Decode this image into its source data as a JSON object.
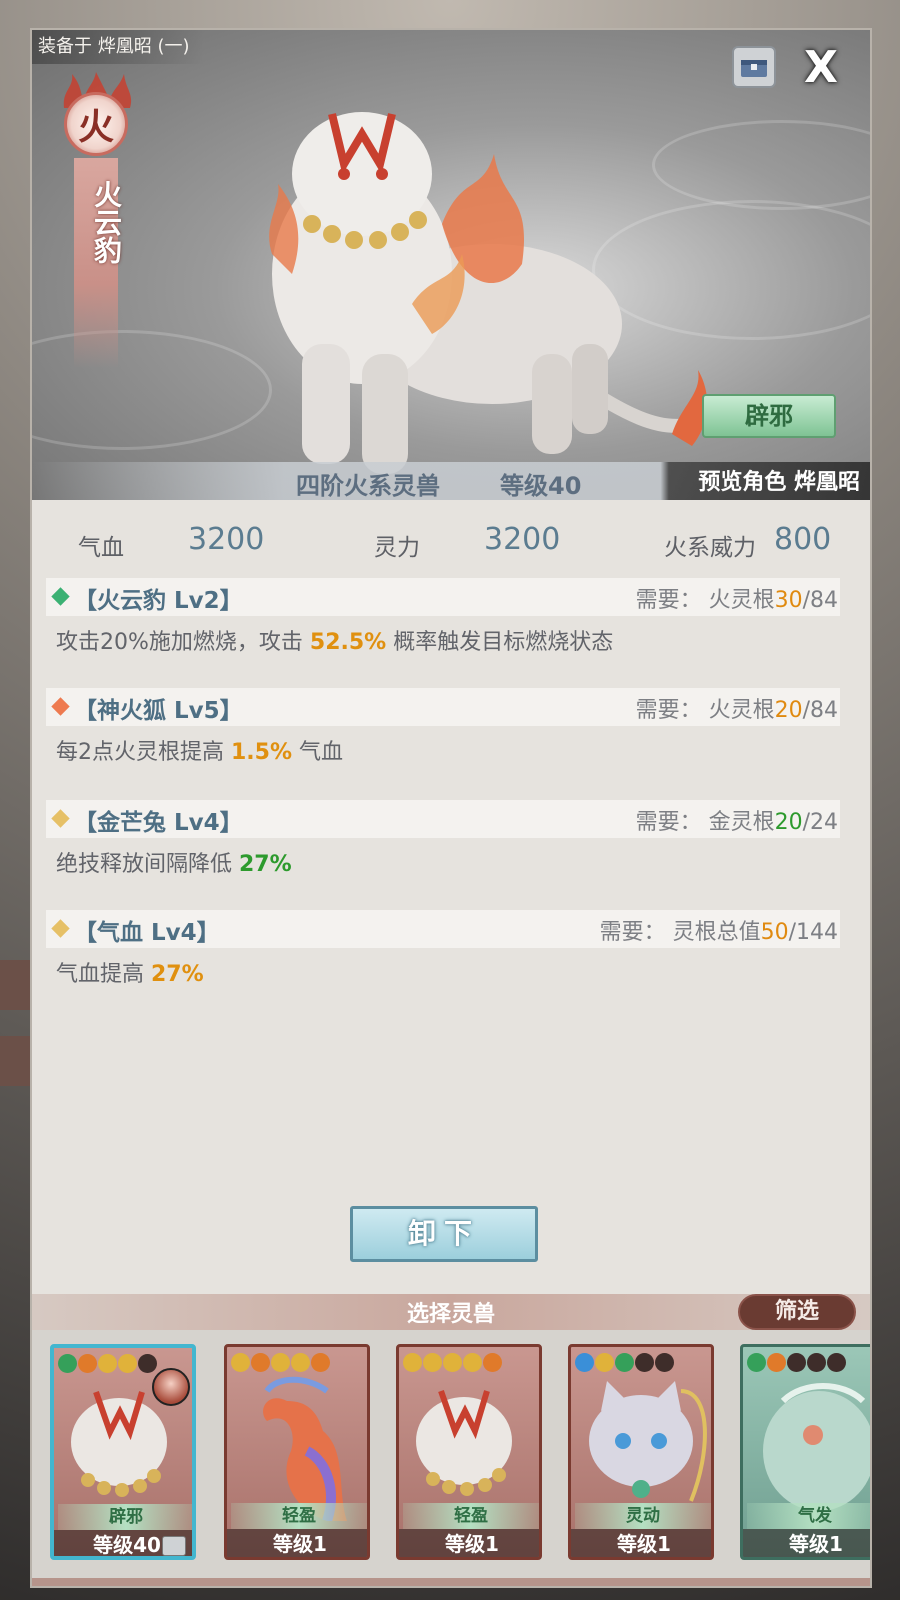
{
  "header": {
    "equipped_on": "装备于 烨凰昭 (一)",
    "close_glyph": "X"
  },
  "beast": {
    "element": "火",
    "name": "火云豹",
    "trait": "辟邪",
    "tier": "四阶火系灵兽",
    "level_text": "等级40",
    "preview_character": "预览角色 烨凰昭"
  },
  "stats": [
    {
      "label": "气血",
      "value": "3200"
    },
    {
      "label": "灵力",
      "value": "3200"
    },
    {
      "label": "火系威力",
      "value": "800"
    }
  ],
  "skills": [
    {
      "name": "【火云豹 Lv2】",
      "diamond_color": "#3bb173",
      "req_prefix": "需要：  火灵根",
      "req_current": "30",
      "req_current_color": "orange",
      "req_total": "/84",
      "desc_before": "攻击20%施加燃烧，攻击 ",
      "desc_highlight": "52.5%",
      "desc_highlight_color": "orange",
      "desc_after": " 概率触发目标燃烧状态"
    },
    {
      "name": "【神火狐 Lv5】",
      "diamond_color": "#ee7a4f",
      "req_prefix": "需要：  火灵根",
      "req_current": "20",
      "req_current_color": "orange",
      "req_total": "/84",
      "desc_before": "每2点火灵根提高 ",
      "desc_highlight": "1.5%",
      "desc_highlight_color": "orange",
      "desc_after": " 气血"
    },
    {
      "name": "【金芒兔 Lv4】",
      "diamond_color": "#e6c066",
      "req_prefix": "需要：  金灵根",
      "req_current": "20",
      "req_current_color": "green",
      "req_total": "/24",
      "desc_before": "绝技释放间隔降低 ",
      "desc_highlight": "27%",
      "desc_highlight_color": "green",
      "desc_after": ""
    },
    {
      "name": "【气血 Lv4】",
      "diamond_color": "#e6c066",
      "req_prefix": "需要：  灵根总值",
      "req_current": "50",
      "req_current_color": "orange",
      "req_total": "/144",
      "desc_before": "气血提高 ",
      "desc_highlight": "27%",
      "desc_highlight_color": "orange",
      "desc_after": ""
    }
  ],
  "actions": {
    "unequip": "卸下",
    "select_title": "选择灵兽",
    "filter": "筛选"
  },
  "cards": [
    {
      "trait": "辟邪",
      "level": "等级40",
      "paws": [
        "green",
        "orange",
        "gold",
        "gold",
        "dark"
      ],
      "selected": true
    },
    {
      "trait": "轻盈",
      "level": "等级1",
      "paws": [
        "gold",
        "orange",
        "gold",
        "gold",
        "orange"
      ],
      "selected": false
    },
    {
      "trait": "轻盈",
      "level": "等级1",
      "paws": [
        "gold",
        "gold",
        "gold",
        "gold",
        "orange"
      ],
      "selected": false
    },
    {
      "trait": "灵动",
      "level": "等级1",
      "paws": [
        "blue",
        "gold",
        "green",
        "dark",
        "dark"
      ],
      "selected": false
    },
    {
      "trait": "气发",
      "level": "等级1",
      "paws": [
        "green",
        "orange",
        "dark",
        "dark",
        "dark"
      ],
      "selected": false
    }
  ],
  "colors": {
    "accent_blue": "#5b7c90",
    "highlight_orange": "#e0900f",
    "highlight_green": "#2d9a2d",
    "trait_green": "#2f6f45"
  }
}
